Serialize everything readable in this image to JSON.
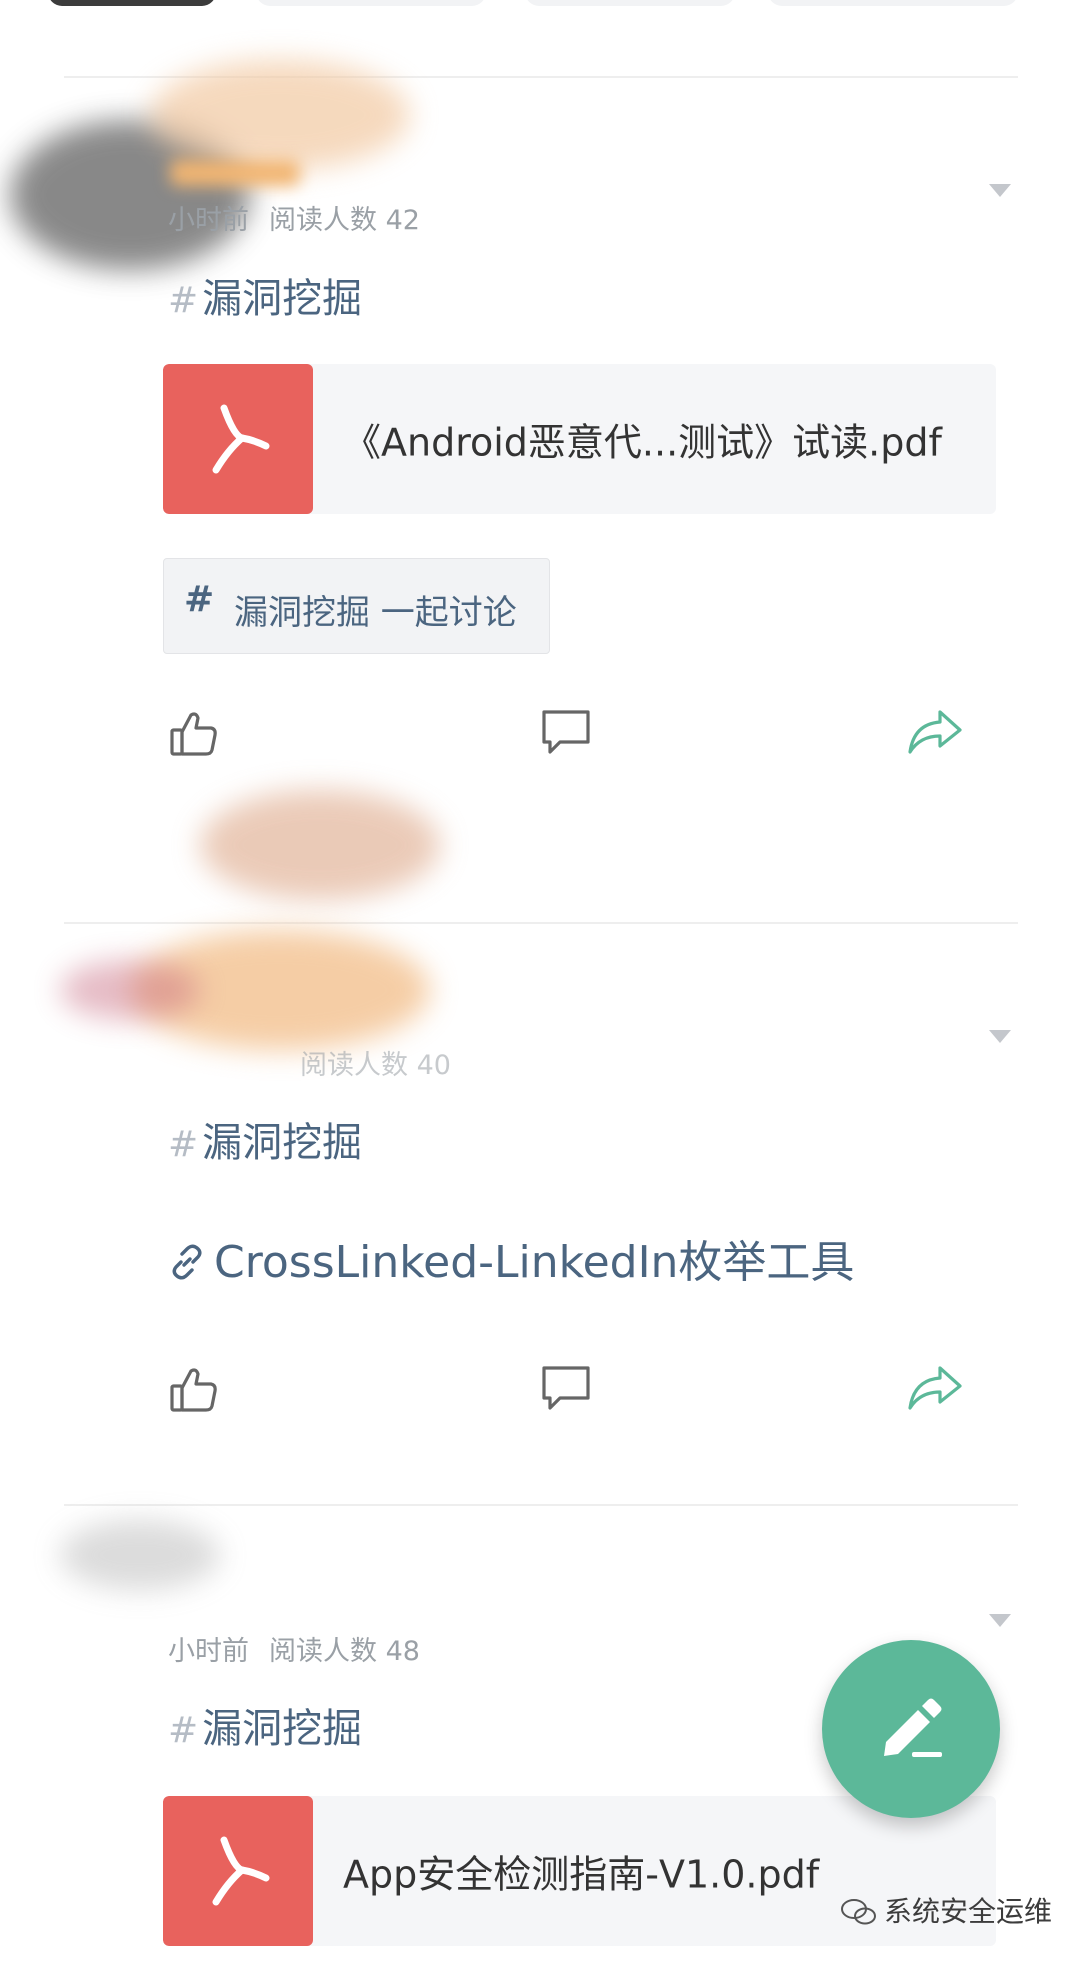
{
  "posts": [
    {
      "time": "小时前",
      "read_label": "阅读人数 42",
      "topic": "漏洞挖掘",
      "attachment": {
        "file_name": "《Android恶意代...测试》试读.pdf"
      },
      "topic_chip": {
        "hash": "#",
        "label": "漏洞挖掘 一起讨论"
      }
    },
    {
      "time": "",
      "read_label": "阅读人数 40",
      "topic": "漏洞挖掘",
      "link_text": "CrossLinked-LinkedIn枚举工具"
    },
    {
      "time": "小时前",
      "read_label": "阅读人数 48",
      "topic": "漏洞挖掘",
      "attachment": {
        "file_name": "App安全检测指南-V1.0.pdf"
      }
    }
  ],
  "topic_hash": "#",
  "watermark": "系统安全运维",
  "icons": {
    "like": "thumbs-up-icon",
    "comment": "comment-icon",
    "share": "share-icon",
    "more": "chevron-down-icon",
    "file": "pdf-icon",
    "link": "link-icon",
    "fab": "edit-pencil-icon"
  },
  "colors": {
    "accent": "#5cb899",
    "pdf_tile": "#e8625d",
    "topic_text": "#4b6580",
    "meta_text": "#9aa0a6"
  }
}
